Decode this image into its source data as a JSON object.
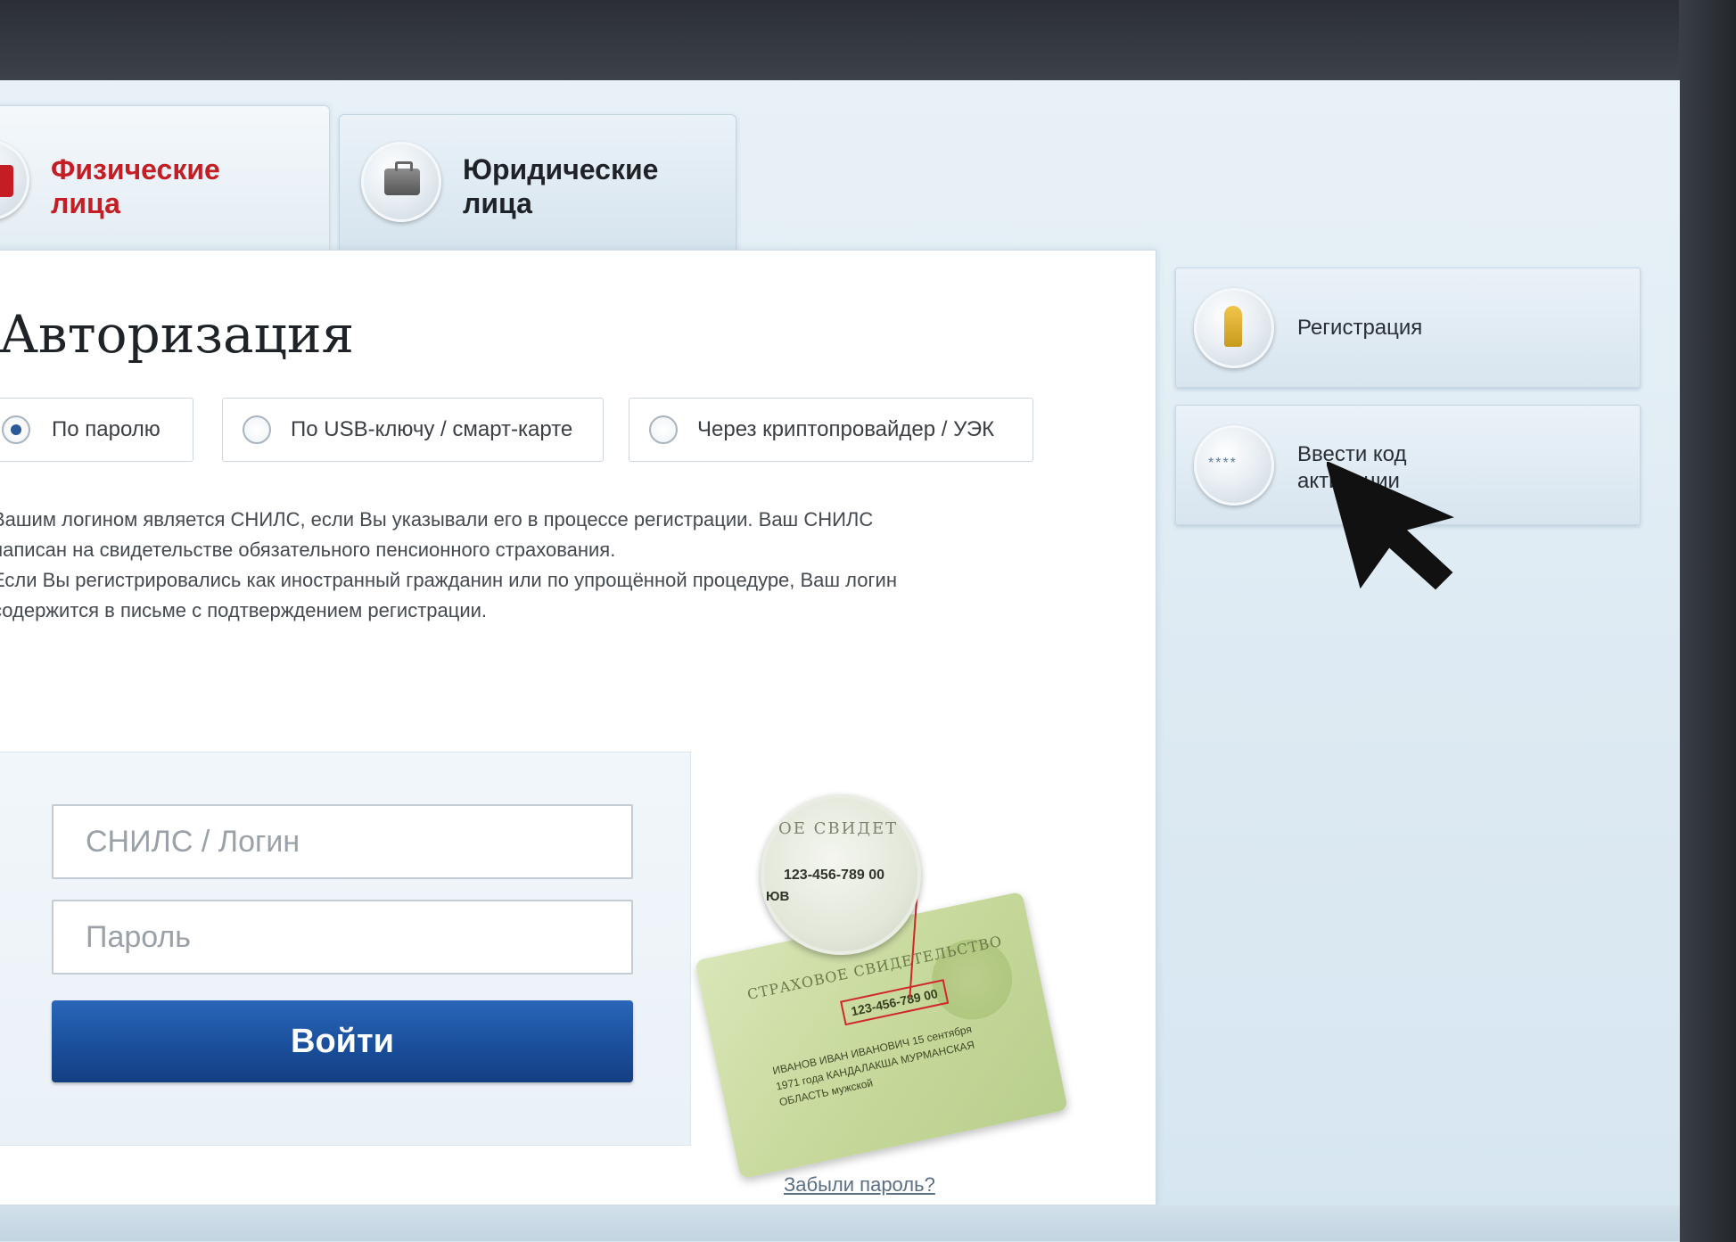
{
  "tabs": {
    "physical": {
      "label": "Физические\nлица",
      "active": true
    },
    "juridical": {
      "label": "Юридические\nлица",
      "active": false
    }
  },
  "auth": {
    "title": "Авторизация",
    "options": [
      {
        "label": "По паролю",
        "checked": true
      },
      {
        "label": "По USB-ключу / смарт-карте",
        "checked": false
      },
      {
        "label": "Через криптопровайдер / УЭК",
        "checked": false
      }
    ],
    "help": [
      "Вашим логином является СНИЛС, если Вы указывали его в процессе регистрации. Ваш СНИЛС",
      "написан на свидетельстве обязательного пенсионного страхования.",
      "Если Вы регистрировались как иностранный гражданин или по упрощённой процедуре, Ваш логин",
      "содержится в письме с подтверждением регистрации."
    ],
    "login_placeholder": "СНИЛС / Логин",
    "password_placeholder": "Пароль",
    "submit_label": "Войти",
    "forgot_label": "Забыли пароль?"
  },
  "illustration": {
    "magnifier_title": "ОЕ СВИДЕТ",
    "magnifier_number": "123-456-789 00",
    "magnifier_surname_fragment": "ЮВ",
    "card_title": "СТРАХОВОЕ СВИДЕТЕЛЬСТВО",
    "card_number": "123-456-789 00",
    "card_lines": "ИВАНОВ ИВАН ИВАНОВИЧ  15 сентября 1971 года  КАНДАЛАКША МУРМАНСКАЯ ОБЛАСТЬ  мужской"
  },
  "side": {
    "register_label": "Регистрация",
    "code_label": "Ввести код\nактивации",
    "code_icon_text": "****"
  },
  "colors": {
    "accent_red": "#c41e24",
    "button_blue": "#1a4f9c"
  }
}
